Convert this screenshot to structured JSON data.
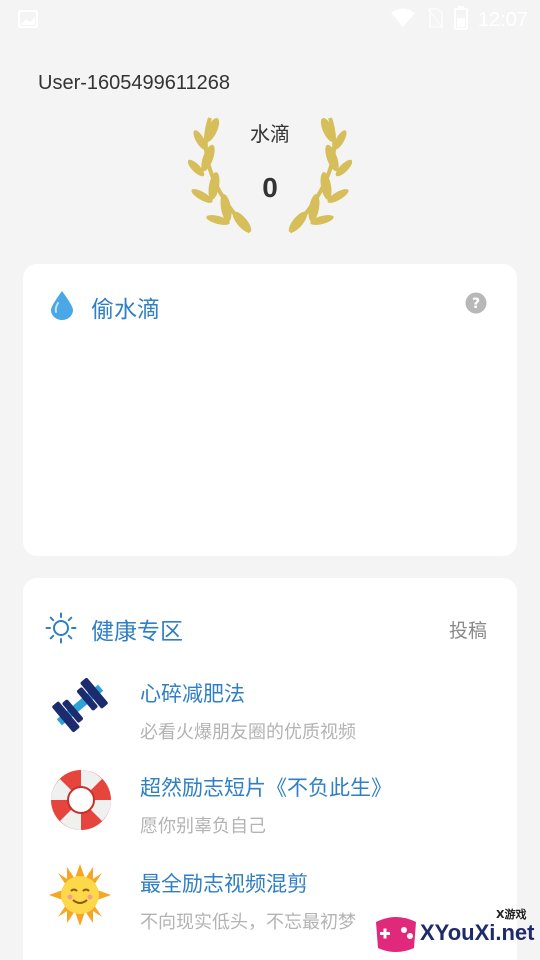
{
  "status_bar": {
    "time": "12:07",
    "icons": [
      "image-icon",
      "wifi-icon",
      "no-sim-icon",
      "battery-icon"
    ]
  },
  "profile": {
    "username": "User-1605499611268",
    "drops_label": "水滴",
    "drops_count": "0"
  },
  "steal_card": {
    "title": "偷水滴",
    "icon": "water-drop-icon",
    "help_icon": "question-circle-icon"
  },
  "health_card": {
    "title": "健康专区",
    "icon": "sun-outline-icon",
    "submit_label": "投稿",
    "items": [
      {
        "title": "心碎减肥法",
        "subtitle": "必看火爆朋友圈的优质视频",
        "icon": "dumbbell-icon"
      },
      {
        "title": "超然励志短片《不负此生》",
        "subtitle": "愿你别辜负自己",
        "icon": "lifebuoy-icon"
      },
      {
        "title": "最全励志视频混剪",
        "subtitle": "不向现实低头，不忘最初梦",
        "icon": "sun-face-icon"
      }
    ]
  },
  "watermark": {
    "small": "X游戏",
    "text": "XYouXi.net"
  },
  "colors": {
    "accent": "#2f7fc4",
    "background": "#f4f4f4",
    "laurel": "#d6bf5a"
  }
}
